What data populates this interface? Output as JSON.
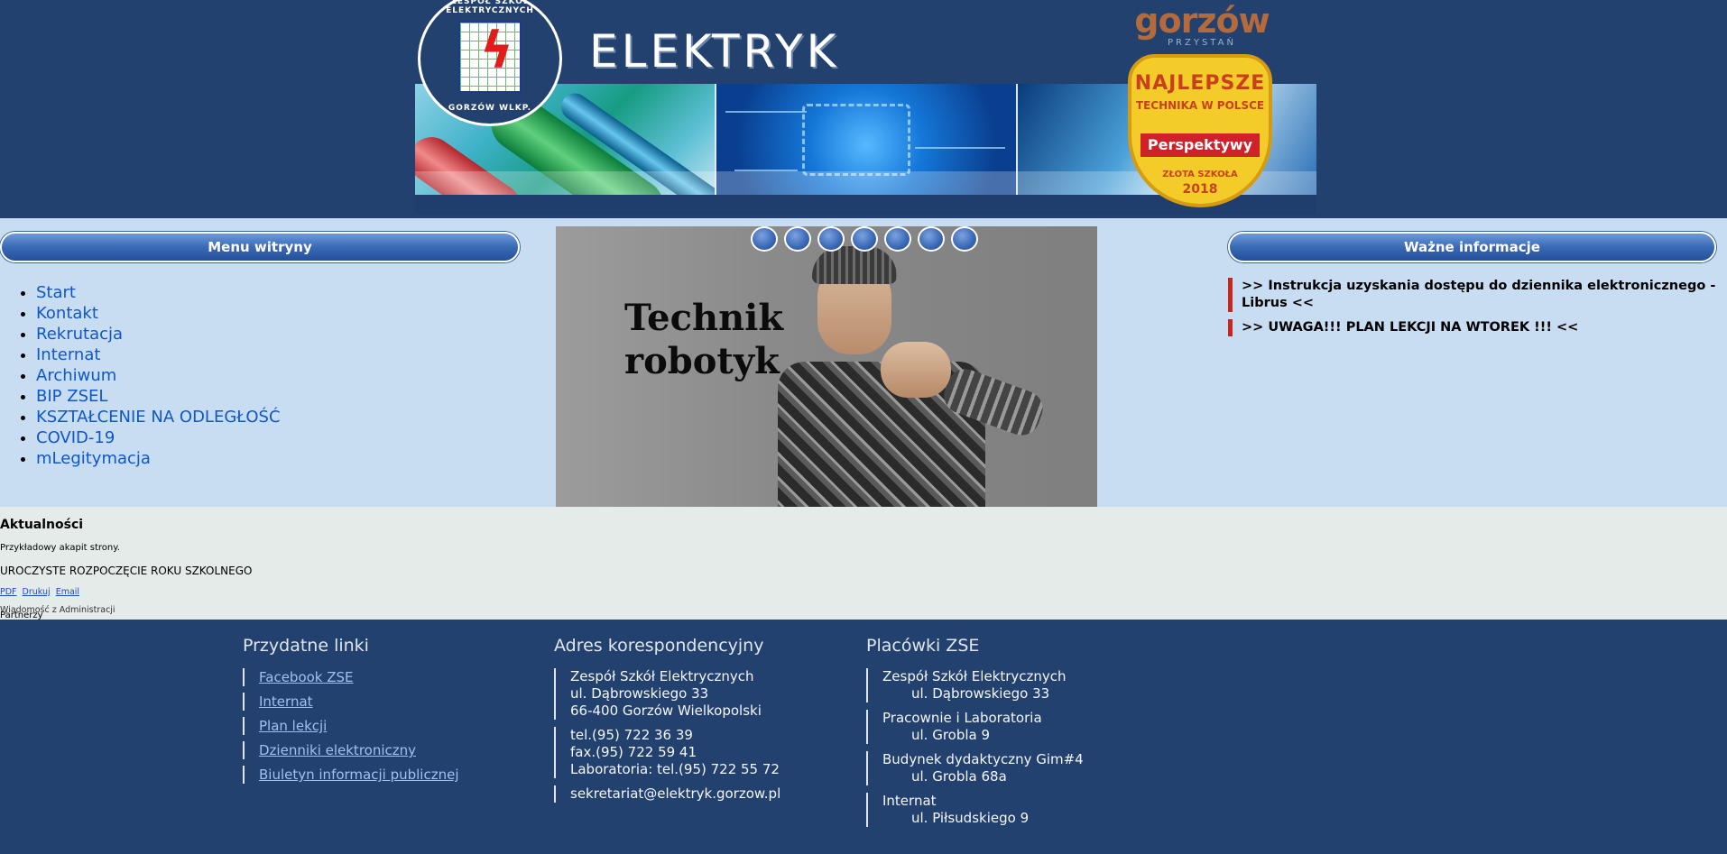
{
  "header": {
    "site_title": "ELEKTRYK",
    "seal_text_top": "ZESPÓŁ SZKÓŁ ELEKTRYCZNYCH",
    "seal_text_bottom": "GORZÓW WLKP.",
    "city_logo_main": "gorzów",
    "city_logo_sub": "PRZYSTAŃ",
    "award": {
      "line1": "NAJLEPSZE",
      "line2": "TECHNIKA W POLSCE",
      "ribbon": "Perspektywy",
      "line3": "ZŁOTA SZKOŁA",
      "year": "2018"
    }
  },
  "menu": {
    "title": "Menu witryny",
    "items": [
      {
        "label": "Start"
      },
      {
        "label": "Kontakt"
      },
      {
        "label": "Rekrutacja"
      },
      {
        "label": "Internat"
      },
      {
        "label": "Archiwum"
      },
      {
        "label": "BIP ZSEL"
      },
      {
        "label": "KSZTAŁCENIE NA ODLEGŁOŚĆ"
      },
      {
        "label": "COVID-19"
      },
      {
        "label": "mLegitymacja"
      }
    ]
  },
  "slider": {
    "caption_line1": "Technik",
    "caption_line2": "robotyk",
    "dot_count": 7
  },
  "info": {
    "title": "Ważne informacje",
    "items": [
      {
        "text": ">> Instrukcja uzyskania dostępu do dziennika elektronicznego - Librus <<"
      },
      {
        "text": ">> UWAGA!!! PLAN LEKCJI NA WTOREK !!! <<"
      }
    ]
  },
  "news": {
    "title": "Aktualności",
    "sample_paragraph": "Przykładowy akapit strony.",
    "headline": "UROCZYSTE ROZPOCZĘCIE ROKU SZKOLNEGO",
    "actions": [
      "PDF",
      "Drukuj",
      "Email"
    ],
    "overlap_text": "Wiadomość z Administracji",
    "partners_label": "Partnerzy"
  },
  "footer": {
    "links_title": "Przydatne linki",
    "links": [
      "Facebook ZSE",
      "Internat",
      "Plan lekcji",
      "Dzienniki elektroniczny",
      "Biuletyn informacji publicznej"
    ],
    "address_title": "Adres korespondencyjny",
    "address": {
      "name": "Zespół Szkół Elektrycznych",
      "street": "ul. Dąbrowskiego 33",
      "city": "66-400 Gorzów Wielkopolski",
      "tel": "tel.(95) 722 36 39",
      "fax": "fax.(95) 722 59 41",
      "lab": "Laboratoria: tel.(95) 722 55 72",
      "email": "sekretariat@elektryk.gorzow.pl"
    },
    "branches_title": "Placówki ZSE",
    "branches": [
      {
        "name": "Zespół Szkół Elektrycznych",
        "address": "ul. Dąbrowskiego 33"
      },
      {
        "name": "Pracownie i Laboratoria",
        "address": "ul. Grobla 9"
      },
      {
        "name": "Budynek dydaktyczny Gim#4",
        "address": "ul. Grobla 68a"
      },
      {
        "name": "Internat",
        "address": "ul. Piłsudskiego 9"
      }
    ]
  }
}
